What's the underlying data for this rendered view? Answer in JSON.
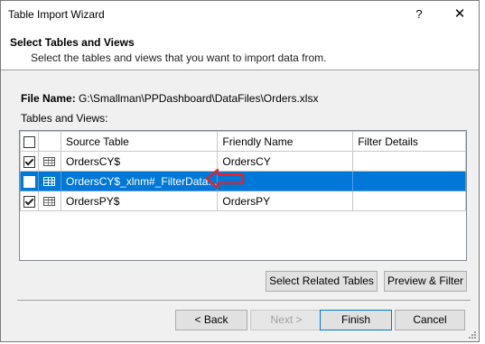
{
  "window": {
    "title": "Table Import Wizard",
    "help_glyph": "?",
    "close_glyph": "✕"
  },
  "header": {
    "title": "Select Tables and Views",
    "description": "Select the tables and views that you want to import data from."
  },
  "file": {
    "label": "File Name:",
    "path": "G:\\Smallman\\PPDashboard\\DataFiles\\Orders.xlsx"
  },
  "tables_label": "Tables and Views:",
  "grid": {
    "columns": [
      "Source Table",
      "Friendly Name",
      "Filter Details"
    ],
    "rows": [
      {
        "checked": true,
        "selected": false,
        "source": "OrdersCY$",
        "friendly": "OrdersCY",
        "filter": ""
      },
      {
        "checked": false,
        "selected": true,
        "source": "OrdersCY$_xlnm#_FilterData...",
        "friendly": "",
        "filter": ""
      },
      {
        "checked": true,
        "selected": false,
        "source": "OrdersPY$",
        "friendly": "OrdersPY",
        "filter": ""
      }
    ]
  },
  "buttons": {
    "select_related": "Select Related Tables",
    "preview_filter": "Preview & Filter",
    "back": "< Back",
    "next": "Next >",
    "finish": "Finish",
    "cancel": "Cancel"
  },
  "colors": {
    "selection": "#0078d7",
    "annotation_arrow": "#e8202a"
  },
  "icons": [
    "table-icon",
    "checkbox-icon",
    "red-arrow-annotation-icon",
    "close-icon",
    "help-icon",
    "resize-grip-icon"
  ]
}
